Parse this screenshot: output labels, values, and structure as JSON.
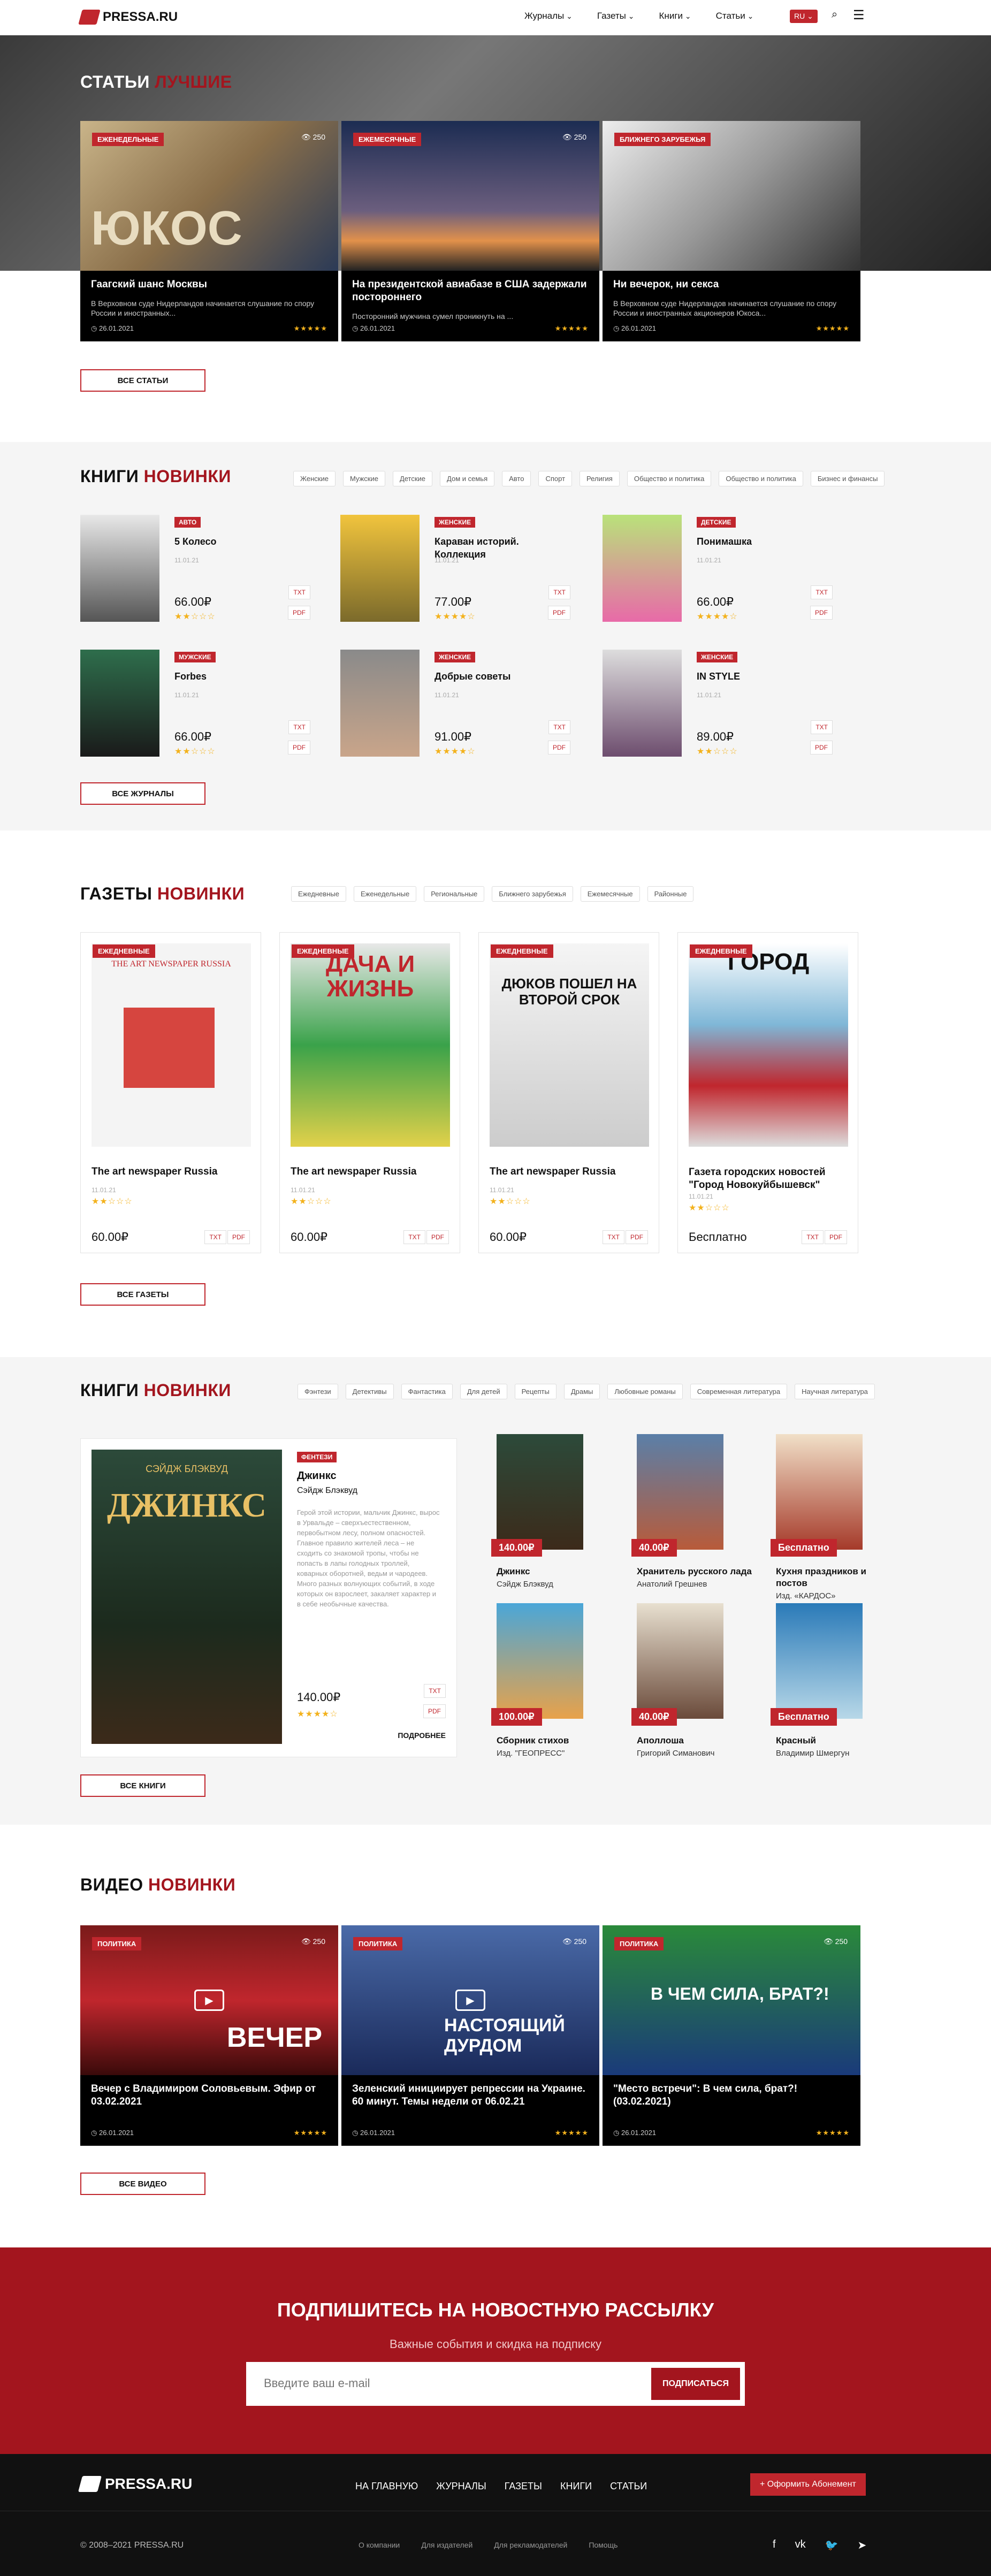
{
  "header": {
    "logo": "PRESSA.RU",
    "nav": [
      "Журналы",
      "Газеты",
      "Книги",
      "Статьи"
    ],
    "lang": "RU"
  },
  "articles": {
    "title_a": "СТАТЬИ",
    "title_b": "ЛУЧШИЕ",
    "button": "ВСЕ СТАТЬИ",
    "items": [
      {
        "badge": "ЕЖЕНЕДЕЛЬНЫЕ",
        "views": "250",
        "title": "Гаагский шанс Москвы",
        "desc": "В Верховном суде Нидерландов начинается слушание по спору России и иностранных...",
        "date": "26.01.2021",
        "stars": "★★★★★"
      },
      {
        "badge": "ЕЖЕМЕСЯЧНЫЕ",
        "views": "250",
        "title": "На президентской авиабазе в США задержали постороннего",
        "desc": "Посторонний мужчина сумел проникнуть на ...",
        "date": "26.01.2021",
        "stars": "★★★★★"
      },
      {
        "badge": "БЛИЖНЕГО ЗАРУБЕЖЬЯ",
        "views": "",
        "title": "Ни вечерок, ни секса",
        "desc": "В Верховном суде Нидерландов начинается слушание по спору России и иностранных акционеров Юкоса...",
        "date": "26.01.2021",
        "stars": "★★★★★"
      }
    ]
  },
  "magazines": {
    "title_a": "КНИГИ",
    "title_b": "НОВИНКИ",
    "button": "ВСЕ ЖУРНАЛЫ",
    "tags": [
      "Женские",
      "Мужские",
      "Детские",
      "Дом и семья",
      "Авто",
      "Спорт",
      "Религия",
      "Общество и политика",
      "Общество и политика",
      "Бизнес и финансы"
    ],
    "items": [
      {
        "badge": "АВТО",
        "title": "5 Колесо",
        "date": "11.01.21",
        "price": "66.00₽",
        "stars": "★★☆☆☆",
        "c1": "TXT",
        "c2": "PDF"
      },
      {
        "badge": "ЖЕНСКИЕ",
        "title": "Караван историй. Коллекция",
        "date": "11.01.21",
        "price": "77.00₽",
        "stars": "★★★★☆",
        "c1": "TXT",
        "c2": "PDF"
      },
      {
        "badge": "ДЕТСКИЕ",
        "title": "Понимашка",
        "date": "11.01.21",
        "price": "66.00₽",
        "stars": "★★★★☆",
        "c1": "TXT",
        "c2": "PDF"
      },
      {
        "badge": "МУЖСКИЕ",
        "title": "Forbes",
        "date": "11.01.21",
        "price": "66.00₽",
        "stars": "★★☆☆☆",
        "c1": "TXT",
        "c2": "PDF"
      },
      {
        "badge": "ЖЕНСКИЕ",
        "title": "Добрые советы",
        "date": "11.01.21",
        "price": "91.00₽",
        "stars": "★★★★☆",
        "c1": "TXT",
        "c2": "PDF"
      },
      {
        "badge": "ЖЕНСКИЕ",
        "title": "IN STYLE",
        "date": "11.01.21",
        "price": "89.00₽",
        "stars": "★★☆☆☆",
        "c1": "TXT",
        "c2": "PDF"
      }
    ]
  },
  "newspapers": {
    "title_a": "ГАЗЕТЫ",
    "title_b": "НОВИНКИ",
    "button": "ВСЕ ГАЗЕТЫ",
    "tags": [
      "Ежедневные",
      "Еженедельные",
      "Региональные",
      "Ближнего зарубежья",
      "Ежемесячные",
      "Районные"
    ],
    "items": [
      {
        "badge": "ЕЖЕДНЕВНЫЕ",
        "title": "The art newspaper Russia",
        "date": "11.01.21",
        "stars": "★★☆☆☆",
        "price": "60.00₽",
        "f1": "TXT",
        "f2": "PDF",
        "cover": "THE ART NEWSPAPER RUSSIA"
      },
      {
        "badge": "ЕЖЕДНЕВНЫЕ",
        "title": "The art newspaper Russia",
        "date": "11.01.21",
        "stars": "★★☆☆☆",
        "price": "60.00₽",
        "f1": "TXT",
        "f2": "PDF",
        "cover": "ДАЧА И ЖИЗНЬ"
      },
      {
        "badge": "ЕЖЕДНЕВНЫЕ",
        "title": "The art newspaper Russia",
        "date": "11.01.21",
        "stars": "★★☆☆☆",
        "price": "60.00₽",
        "f1": "TXT",
        "f2": "PDF",
        "cover": "ДЮКОВ ПОШЕЛ НА ВТОРОЙ СРОК"
      },
      {
        "badge": "ЕЖЕДНЕВНЫЕ",
        "title": "Газета городских новостей \"Город Новокуйбышевск\"",
        "date": "11.01.21",
        "stars": "★★☆☆☆",
        "price": "Бесплатно",
        "f1": "TXT",
        "f2": "PDF",
        "cover": "ГОРОД"
      }
    ]
  },
  "books": {
    "title_a": "КНИГИ",
    "title_b": "НОВИНКИ",
    "button": "ВСЕ КНИГИ",
    "tags": [
      "Фэнтези",
      "Детективы",
      "Фантастика",
      "Для детей",
      "Рецепты",
      "Драмы",
      "Любовные романы",
      "Современная литература",
      "Научная литература"
    ],
    "featured": {
      "badge": "ФЕНТЕЗИ",
      "title": "Джинкс",
      "author": "Сэйдж Блэквуд",
      "desc": "Герой этой истории, мальчик Джинкс, вырос в Урвальде – сверхъестественном, первобытном лесу, полном опасностей. Главное правило жителей леса – не сходить со знакомой тропы, чтобы не попасть в лапы голодных троллей, коварных оборотней, ведьм и чародеев. Много разных волнующих событий, в ходе которых он взрослеет, закаляет характер и в себе необычные качества.",
      "price": "140.00₽",
      "stars": "★★★★☆",
      "more": "ПОДРОБНЕЕ",
      "f1": "TXT",
      "f2": "PDF",
      "cover_author": "СЭЙДЖ БЛЭКВУД",
      "cover_title": "ДЖИНКС"
    },
    "items": [
      {
        "price": "140.00₽",
        "title": "Джинкс",
        "author": "Сэйдж Блэквуд"
      },
      {
        "price": "40.00₽",
        "title": "Хранитель русского лада",
        "author": "Анатолий Грешнев"
      },
      {
        "price": "Бесплатно",
        "title": "Кухня праздников и постов",
        "author": "Изд. «КАРДОС»"
      },
      {
        "price": "100.00₽",
        "title": "Сборник стихов",
        "author": "Изд. \"ГЕОПРЕСС\""
      },
      {
        "price": "40.00₽",
        "title": "Аполлоша",
        "author": "Григорий Симанович"
      },
      {
        "price": "Бесплатно",
        "title": "Красный",
        "author": "Владимир Шмергун"
      }
    ]
  },
  "videos": {
    "title_a": "ВИДЕО",
    "title_b": "НОВИНКИ",
    "button": "ВСЕ ВИДЕО",
    "items": [
      {
        "badge": "ПОЛИТИКА",
        "views": "250",
        "title": "Вечер с Владимиром Соловьевым. Эфир от 03.02.2021",
        "date": "26.01.2021",
        "stars": "★★★★★",
        "overlay": "ВЕЧЕР"
      },
      {
        "badge": "ПОЛИТИКА",
        "views": "250",
        "title": "Зеленский инициирует репрессии на Украине. 60 минут. Темы недели от 06.02.21",
        "date": "26.01.2021",
        "stars": "★★★★★",
        "overlay": "НАСТОЯЩИЙ ДУРДОМ"
      },
      {
        "badge": "ПОЛИТИКА",
        "views": "250",
        "title": "\"Место встречи\": В чем сила, брат?! (03.02.2021)",
        "date": "26.01.2021",
        "stars": "★★★★★",
        "overlay": "В ЧЕМ СИЛА, БРАТ?!"
      }
    ]
  },
  "subscribe": {
    "title": "ПОДПИШИТЕСЬ НА НОВОСТНУЮ РАССЫЛКУ",
    "subtitle": "Важные события и скидка на подписку",
    "placeholder": "Введите ваш e-mail",
    "button": "ПОДПИСАТЬСЯ"
  },
  "footer": {
    "logo": "PRESSA.RU",
    "nav": [
      "НА ГЛАВНУЮ",
      "ЖУРНАЛЫ",
      "ГАЗЕТЫ",
      "КНИГИ",
      "СТАТЬИ"
    ],
    "subscribe": "+ Оформить Абонемент",
    "copy": "© 2008–2021 PRESSA.RU",
    "links": [
      "О компании",
      "Для издателей",
      "Для рекламодателей",
      "Помощь"
    ],
    "social": [
      "f",
      "vk",
      "tw",
      "tg"
    ]
  }
}
